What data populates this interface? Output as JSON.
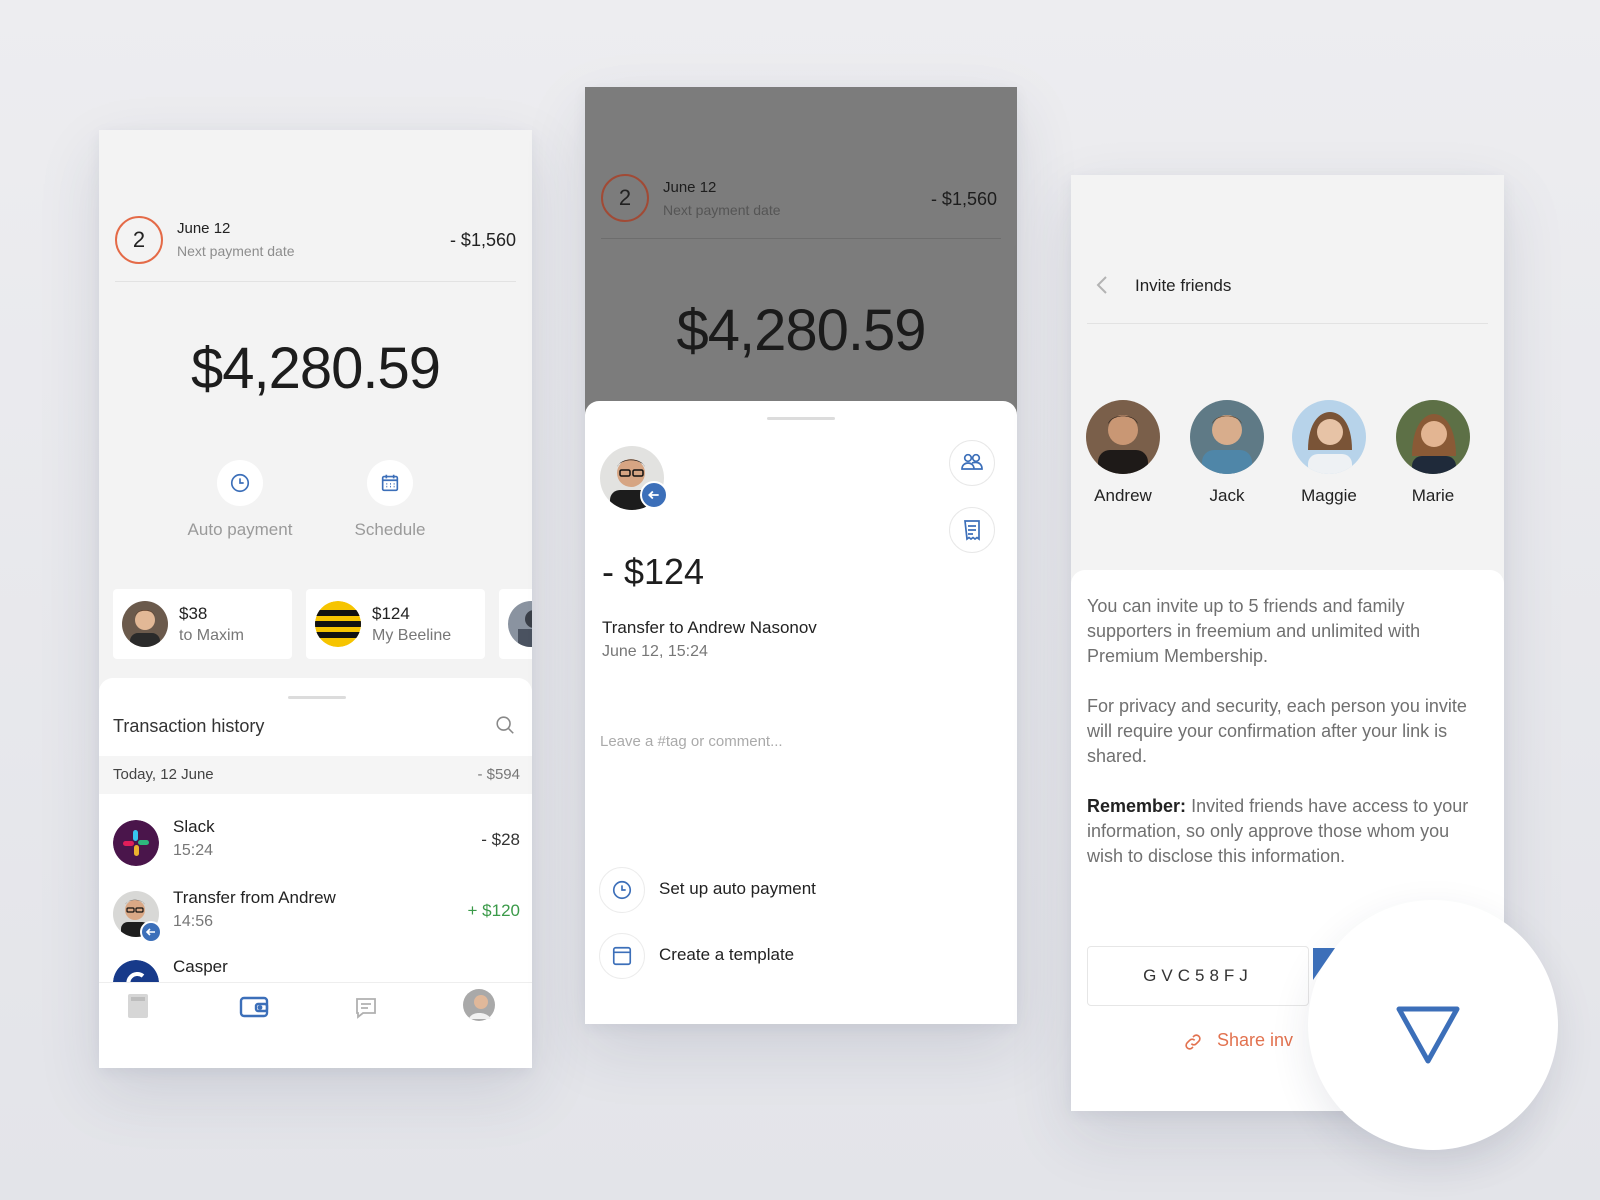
{
  "screen1": {
    "payment": {
      "count": "2",
      "date": "June 12",
      "subtitle": "Next payment date",
      "amount": "- $1,560"
    },
    "balance": "$4,280.59",
    "actions": [
      {
        "label": "Auto payment",
        "icon": "clock-icon"
      },
      {
        "label": "Schedule",
        "icon": "calendar-icon"
      }
    ],
    "recent": [
      {
        "amount": "$38",
        "to": "to Maxim"
      },
      {
        "amount": "$124",
        "to": "My Beeline"
      }
    ],
    "history": {
      "title": "Transaction history",
      "day_label": "Today, 12 June",
      "day_total": "- $594",
      "items": [
        {
          "name": "Slack",
          "time": "15:24",
          "amount": "- $28"
        },
        {
          "name": "Transfer from Andrew",
          "time": "14:56",
          "amount": "+ $120"
        },
        {
          "name": "Casper",
          "time": "",
          "amount": ""
        }
      ]
    },
    "tabs": [
      "document-icon",
      "wallet-icon",
      "chat-icon",
      "profile-avatar"
    ],
    "colors": {
      "accent": "#3c6fb9",
      "ring": "#e46a47",
      "positive": "#3b9a49"
    }
  },
  "screen2": {
    "payment": {
      "count": "2",
      "date": "June 12",
      "subtitle": "Next payment date",
      "amount": "- $1,560"
    },
    "balance": "$4,280.59",
    "detail": {
      "amount": "- $124",
      "title": "Transfer to Andrew Nasonov",
      "when": "June 12, 15:24",
      "comment_placeholder": "Leave a #tag or comment..."
    },
    "options": [
      {
        "label": "Set up auto payment"
      },
      {
        "label": "Create a template"
      }
    ]
  },
  "screen3": {
    "title": "Invite friends",
    "friends": [
      {
        "name": "Andrew"
      },
      {
        "name": "Jack"
      },
      {
        "name": "Maggie"
      },
      {
        "name": "Marie"
      }
    ],
    "para1": "You can invite up to 5 friends and family supporters in freemium and unlimited with Premium Membership.",
    "para2": "For privacy and security, each person you invite will require your confirmation after your link is shared.",
    "remember_label": "Remember:",
    "remember_text": "Invited friends have access to your information, so only approve those whom you wish to disclose this information.",
    "code": "GVC58FJ",
    "share": "Share inv"
  }
}
